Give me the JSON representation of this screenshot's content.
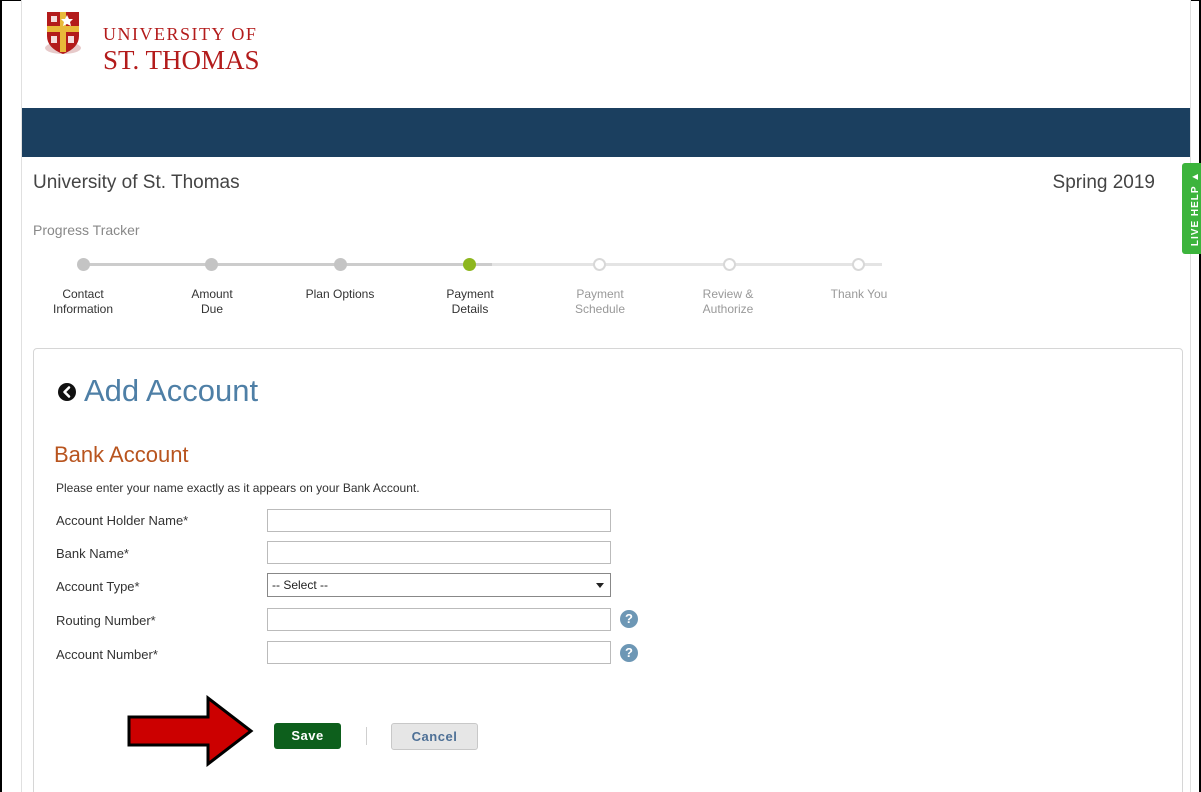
{
  "header": {
    "logo_line1": "UNIVERSITY OF",
    "logo_line2": "ST. THOMAS"
  },
  "context": {
    "school_name": "University of St. Thomas",
    "term": "Spring 2019"
  },
  "live_help": {
    "label": "LIVE HELP"
  },
  "tracker": {
    "label": "Progress Tracker",
    "current_step_index": 3,
    "steps": [
      {
        "line1": "Contact",
        "line2": "Information",
        "state": "done"
      },
      {
        "line1": "Amount",
        "line2": "Due",
        "state": "done"
      },
      {
        "line1": "Plan Options",
        "line2": "",
        "state": "done"
      },
      {
        "line1": "Payment",
        "line2": "Details",
        "state": "current"
      },
      {
        "line1": "Payment",
        "line2": "Schedule",
        "state": "todo"
      },
      {
        "line1": "Review &",
        "line2": "Authorize",
        "state": "todo"
      },
      {
        "line1": "Thank You",
        "line2": "",
        "state": "todo"
      }
    ]
  },
  "form": {
    "title": "Add Account",
    "section_title": "Bank Account",
    "instructions": "Please enter your name exactly as it appears on your Bank Account.",
    "fields": {
      "account_holder_name": {
        "label": "Account Holder Name*",
        "value": ""
      },
      "bank_name": {
        "label": "Bank Name*",
        "value": ""
      },
      "account_type": {
        "label": "Account Type*",
        "selected": "-- Select --"
      },
      "routing_number": {
        "label": "Routing Number*",
        "value": ""
      },
      "account_number": {
        "label": "Account Number*",
        "value": ""
      }
    },
    "help_glyph": "?",
    "save_label": "Save",
    "cancel_label": "Cancel"
  },
  "colors": {
    "nav_band": "#1b3f5f",
    "brand_red": "#b31b1b",
    "current_step": "#8db61e",
    "save_button": "#0d5f1c",
    "live_help": "#3cb43c",
    "annotation_arrow": "#cc0000"
  },
  "icons": {
    "back": "chevron-left-circle-icon",
    "help": "question-circle-icon",
    "select": "caret-down-icon",
    "annotation": "right-arrow-icon"
  }
}
